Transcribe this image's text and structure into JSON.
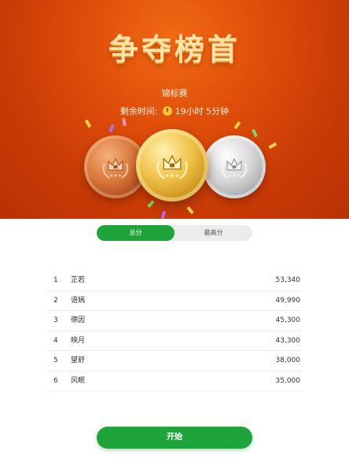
{
  "hero": {
    "title": "争夺榜首",
    "subtitle": "锦标赛",
    "timer_label": "剩余时间:",
    "timer_value": "19小时 5分钟",
    "medals": [
      "bronze-medal",
      "gold-medal",
      "silver-medal"
    ]
  },
  "tabs": {
    "total": "总分",
    "highest": "最高分",
    "active": "total"
  },
  "leaderboard": [
    {
      "rank": "1",
      "name": "芷若",
      "score": "53,340"
    },
    {
      "rank": "2",
      "name": "语嫣",
      "score": "49,990"
    },
    {
      "rank": "3",
      "name": "德因",
      "score": "45,300"
    },
    {
      "rank": "4",
      "name": "映月",
      "score": "43,300"
    },
    {
      "rank": "5",
      "name": "望舒",
      "score": "38,000"
    },
    {
      "rank": "6",
      "name": "风眠",
      "score": "35,000"
    }
  ],
  "start_button": "开始",
  "colors": {
    "hero_orange": "#e04e0a",
    "title_gold": "#ffe2a6",
    "accent_green": "#1fa33b"
  }
}
